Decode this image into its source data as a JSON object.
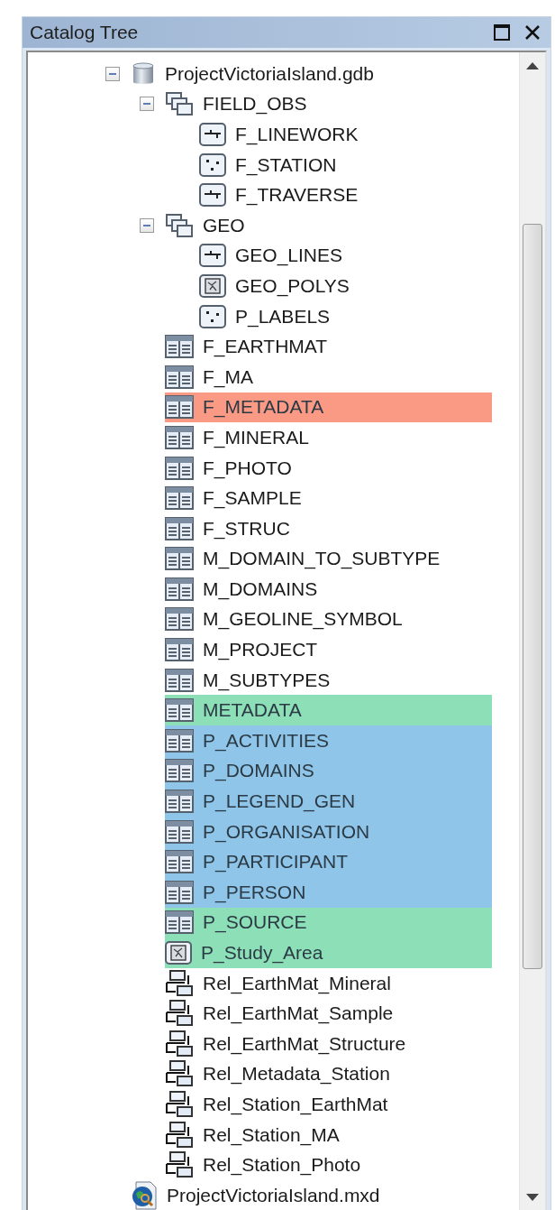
{
  "window": {
    "title": "Catalog Tree"
  },
  "tree": [
    {
      "kind": "geodatabase",
      "label": "ProjectVictoriaIsland.gdb",
      "expanded": true,
      "children": [
        {
          "kind": "dataset",
          "label": "FIELD_OBS",
          "expanded": true,
          "children": [
            {
              "kind": "line",
              "label": "F_LINEWORK"
            },
            {
              "kind": "point",
              "label": "F_STATION"
            },
            {
              "kind": "line",
              "label": "F_TRAVERSE"
            }
          ]
        },
        {
          "kind": "dataset",
          "label": "GEO",
          "expanded": true,
          "children": [
            {
              "kind": "line",
              "label": "GEO_LINES"
            },
            {
              "kind": "polygon",
              "label": "GEO_POLYS"
            },
            {
              "kind": "point",
              "label": "P_LABELS"
            }
          ]
        },
        {
          "kind": "table",
          "label": "F_EARTHMAT"
        },
        {
          "kind": "table",
          "label": "F_MA"
        },
        {
          "kind": "table",
          "label": "F_METADATA",
          "color": "#fa9a85"
        },
        {
          "kind": "table",
          "label": "F_MINERAL"
        },
        {
          "kind": "table",
          "label": "F_PHOTO"
        },
        {
          "kind": "table",
          "label": "F_SAMPLE"
        },
        {
          "kind": "table",
          "label": "F_STRUC"
        },
        {
          "kind": "table",
          "label": "M_DOMAIN_TO_SUBTYPE"
        },
        {
          "kind": "table",
          "label": "M_DOMAINS"
        },
        {
          "kind": "table",
          "label": "M_GEOLINE_SYMBOL"
        },
        {
          "kind": "table",
          "label": "M_PROJECT"
        },
        {
          "kind": "table",
          "label": "M_SUBTYPES"
        },
        {
          "kind": "table",
          "label": "METADATA",
          "color": "#8ddfb8"
        },
        {
          "kind": "table",
          "label": "P_ACTIVITIES",
          "color": "#8ec5e8"
        },
        {
          "kind": "table",
          "label": "P_DOMAINS",
          "color": "#8ec5e8"
        },
        {
          "kind": "table",
          "label": "P_LEGEND_GEN",
          "color": "#8ec5e8"
        },
        {
          "kind": "table",
          "label": "P_ORGANISATION",
          "color": "#8ec5e8"
        },
        {
          "kind": "table",
          "label": "P_PARTICIPANT",
          "color": "#8ec5e8"
        },
        {
          "kind": "table",
          "label": "P_PERSON",
          "color": "#8ec5e8"
        },
        {
          "kind": "table",
          "label": "P_SOURCE",
          "color": "#8ddfb8"
        },
        {
          "kind": "polygon",
          "label": "P_Study_Area",
          "color": "#8ddfb8"
        },
        {
          "kind": "relationship",
          "label": "Rel_EarthMat_Mineral"
        },
        {
          "kind": "relationship",
          "label": "Rel_EarthMat_Sample"
        },
        {
          "kind": "relationship",
          "label": "Rel_EarthMat_Structure"
        },
        {
          "kind": "relationship",
          "label": "Rel_Metadata_Station"
        },
        {
          "kind": "relationship",
          "label": "Rel_Station_EarthMat"
        },
        {
          "kind": "relationship",
          "label": "Rel_Station_MA"
        },
        {
          "kind": "relationship",
          "label": "Rel_Station_Photo"
        }
      ]
    },
    {
      "kind": "map",
      "label": "ProjectVictoriaIsland.mxd"
    }
  ]
}
